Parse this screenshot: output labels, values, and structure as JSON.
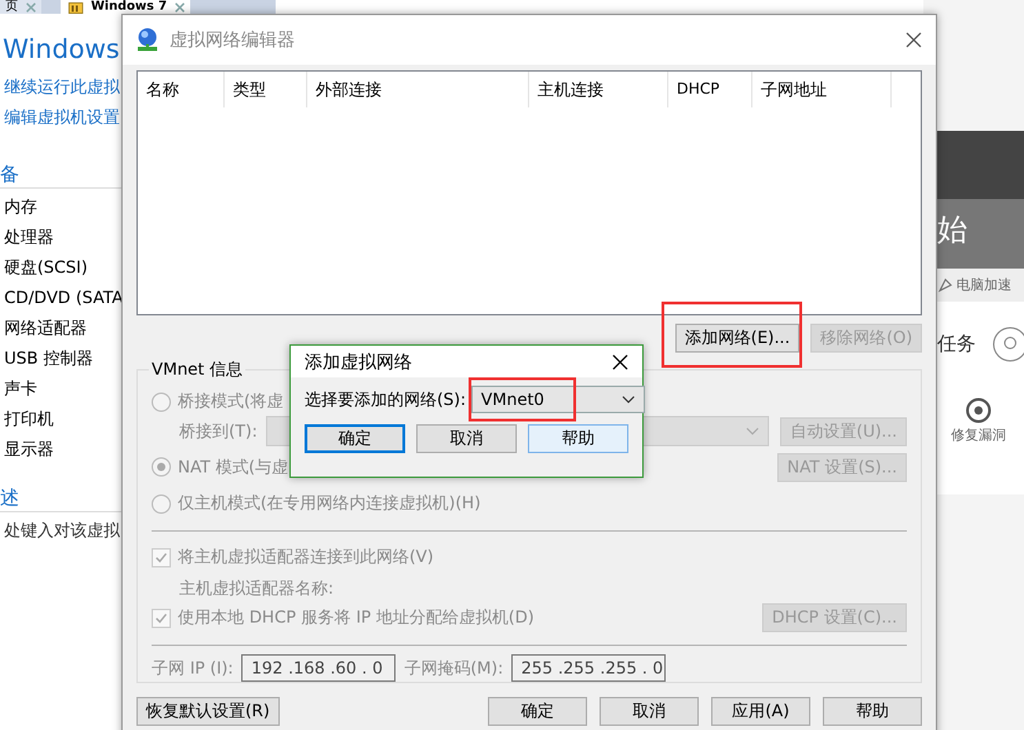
{
  "tabs": [
    {
      "label": "页",
      "selected": false
    },
    {
      "label": "Windows 7",
      "selected": true
    }
  ],
  "vm_page": {
    "title": "Windows",
    "actions": [
      "继续运行此虚拟",
      "编辑虚拟机设置"
    ],
    "devices_heading": "备",
    "devices": [
      "内存",
      "处理器",
      "硬盘(SCSI)",
      "CD/DVD (SATA",
      "网络适配器",
      "USB 控制器",
      "声卡",
      "打印机",
      "显示器"
    ],
    "description_heading": "述",
    "description_prompt": "处键入对该虚拟"
  },
  "background_app": {
    "heading": "始",
    "toolbar_item": "电脑加速",
    "task_label": "任务",
    "tool_label": "修复漏洞"
  },
  "editor": {
    "title": "虚拟网络编辑器",
    "columns": [
      "名称",
      "类型",
      "外部连接",
      "主机连接",
      "DHCP",
      "子网地址"
    ],
    "list_buttons": [
      {
        "label": "添加网络(E)...",
        "disabled": false,
        "highlighted": true
      },
      {
        "label": "移除网络(O)",
        "disabled": true,
        "highlighted": false
      }
    ],
    "group_title": "VMnet 信息",
    "modes": [
      {
        "label": "桥接模式(将虚",
        "selected": false,
        "disabled": true
      },
      {
        "label": "NAT 模式(与虚",
        "selected": true,
        "disabled": true
      },
      {
        "label": "仅主机模式(在专用网络内连接虚拟机)(H)",
        "selected": false,
        "disabled": true
      }
    ],
    "bridge_to_label": "桥接到(T):",
    "auto_button": "自动设置(U)...",
    "nat_button": "NAT 设置(S)...",
    "host_adapter": {
      "label": "将主机虚拟适配器连接到此网络(V)",
      "checked": true,
      "disabled": true
    },
    "adapter_name_label": "主机虚拟适配器名称:",
    "dhcp": {
      "label": "使用本地 DHCP 服务将 IP 地址分配给虚拟机(D)",
      "checked": true,
      "disabled": true
    },
    "dhcp_button": "DHCP 设置(C)...",
    "subnet_ip": {
      "label": "子网 IP (I):",
      "value": "192 .168 .60 . 0"
    },
    "subnet_mask": {
      "label": "子网掩码(M):",
      "value": "255 .255 .255 . 0"
    },
    "buttons": [
      "恢复默认设置(R)",
      "确定",
      "取消",
      "应用(A)",
      "帮助"
    ]
  },
  "add_dialog": {
    "title": "添加虚拟网络",
    "label": "选择要添加的网络(S):",
    "select": {
      "value": "VMnet0",
      "highlighted": true
    },
    "buttons": [
      {
        "label": "确定",
        "focused": true,
        "hovered": false
      },
      {
        "label": "取消",
        "focused": false,
        "hovered": false
      },
      {
        "label": "帮助",
        "focused": false,
        "hovered": true
      }
    ]
  }
}
